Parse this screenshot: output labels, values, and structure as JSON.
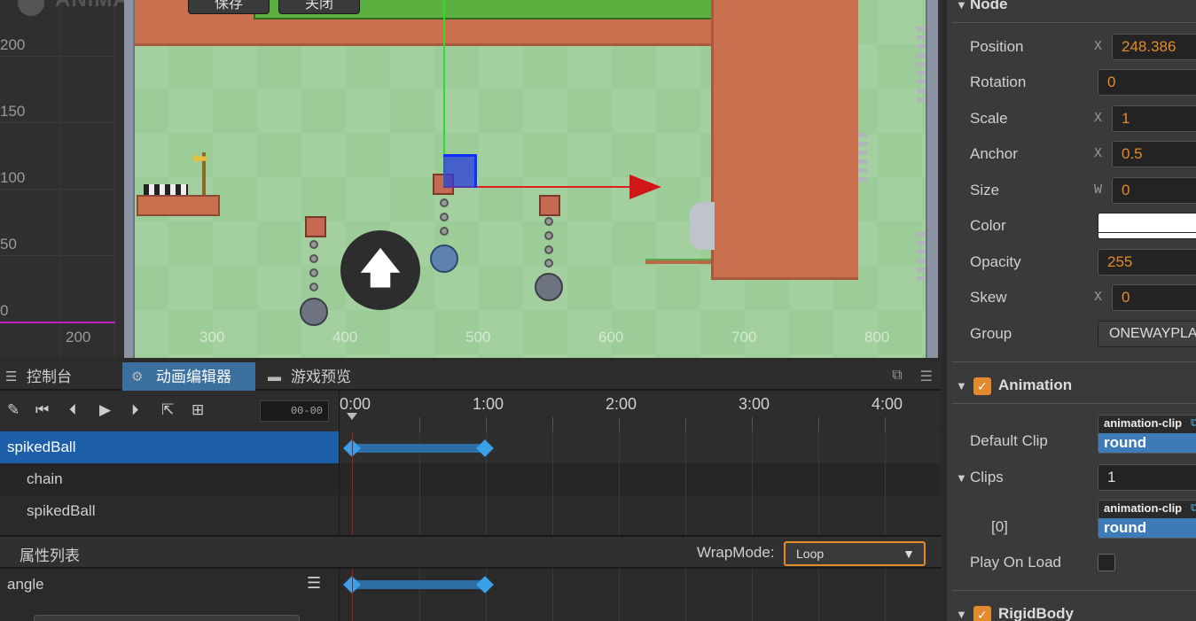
{
  "scene": {
    "logo_text": "ANIMATE",
    "top_buttons": [
      "保存",
      "关闭"
    ],
    "ruler_left_ticks": [
      "200",
      "150",
      "100",
      "50",
      "0"
    ],
    "ruler_bottom_label": "200",
    "x_ticks": [
      "300",
      "400",
      "500",
      "600",
      "700",
      "800"
    ],
    "up_button_glyph": "🡅"
  },
  "tabs": [
    {
      "label": "控制台",
      "icon": "console-icon",
      "active": false
    },
    {
      "label": "动画编辑器",
      "icon": "animation-editor-icon",
      "active": true
    },
    {
      "label": "游戏预览",
      "icon": "game-preview-icon",
      "active": false
    }
  ],
  "anim_toolbar": {
    "time_value": "00-00",
    "buttons": [
      "edit-icon",
      "jump-to-start-icon",
      "prev-frame-icon",
      "play-icon",
      "next-frame-icon",
      "add-event-icon",
      "add-keyframe-icon"
    ]
  },
  "timeline": {
    "labels": [
      "0:00",
      "1:00",
      "2:00",
      "3:00",
      "4:00"
    ]
  },
  "nodes": [
    {
      "name": "spikedBall",
      "selected": true,
      "indent": 0
    },
    {
      "name": "chain",
      "selected": false,
      "indent": 1
    },
    {
      "name": "spikedBall",
      "selected": false,
      "indent": 1
    }
  ],
  "properties": {
    "title": "属性列表",
    "wrap_mode_label": "WrapMode:",
    "wrap_mode_value": "Loop",
    "items": [
      {
        "name": "angle"
      }
    ]
  },
  "inspector": {
    "node_section": "Node",
    "position_label": "Position",
    "position_x": "248.386",
    "rotation_label": "Rotation",
    "rotation_value": "0",
    "scale_label": "Scale",
    "scale_x": "1",
    "anchor_label": "Anchor",
    "anchor_x": "0.5",
    "size_label": "Size",
    "size_w": "0",
    "color_label": "Color",
    "color_value": "#ffffff",
    "opacity_label": "Opacity",
    "opacity_value": "255",
    "skew_label": "Skew",
    "skew_x": "0",
    "group_label": "Group",
    "group_value": "ONEWAYPLA",
    "axis_x": "X",
    "axis_w": "W",
    "animation_section": "Animation",
    "default_clip_label": "Default Clip",
    "asset_type": "animation-clip",
    "default_clip_value": "round",
    "clips_label": "Clips",
    "clips_count": "1",
    "clip0_label": "[0]",
    "clip0_value": "round",
    "play_on_load_label": "Play On Load",
    "rigidbody_section": "RigidBody"
  },
  "colors": {
    "accent_orange": "#e38a2c",
    "selection_blue": "#1c5fa8",
    "keyframe_blue": "#3aa0e8",
    "playhead_red": "#b01818"
  }
}
